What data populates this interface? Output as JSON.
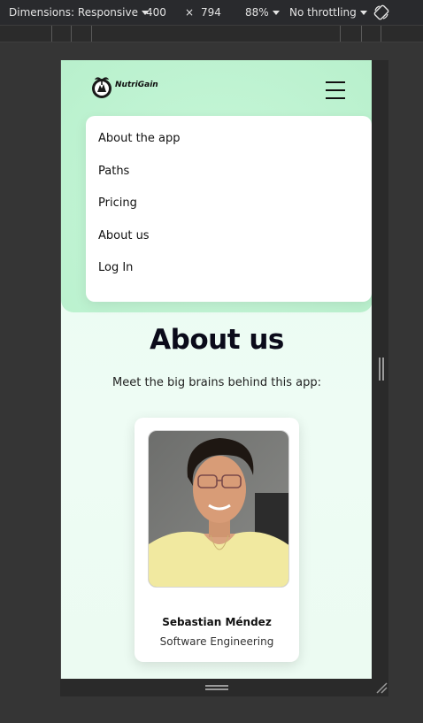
{
  "devtools": {
    "dimensions_label": "Dimensions: Responsive",
    "width": "400",
    "times": "×",
    "height": "794",
    "zoom": "88%",
    "throttling": "No throttling"
  },
  "header": {
    "logo_text": "NutriGain"
  },
  "menu": {
    "items": [
      "About the app",
      "Paths",
      "Pricing",
      "About us",
      "Log In"
    ]
  },
  "about": {
    "title": "About us",
    "subtitle": "Meet the big brains behind this app:"
  },
  "team": [
    {
      "name": "Sebastian Méndez",
      "role": "Software Engineering"
    }
  ]
}
